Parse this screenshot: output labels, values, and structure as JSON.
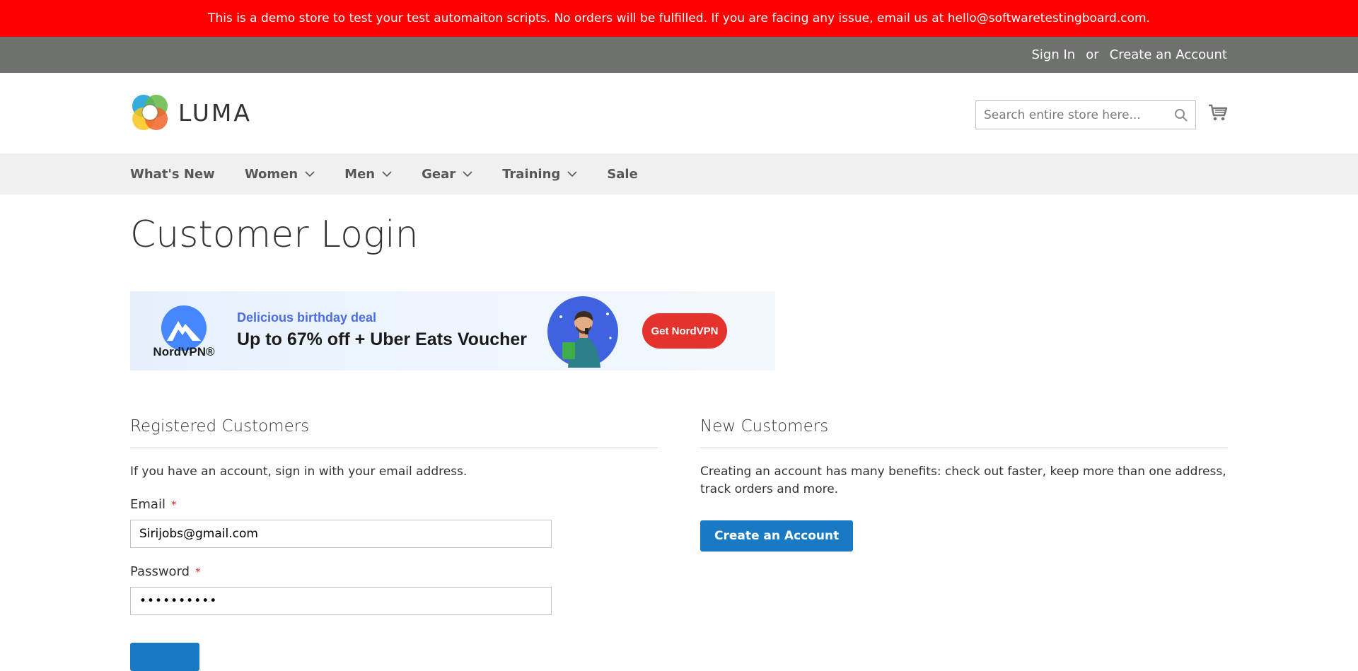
{
  "demo_notice": "This is a demo store to test your test automaiton scripts. No orders will be fulfilled. If you are facing any issue, email us at hello@softwaretestingboard.com.",
  "header": {
    "sign_in": "Sign In",
    "or": "or",
    "create_account": "Create an Account"
  },
  "logo": {
    "text": "LUMA"
  },
  "search": {
    "placeholder": "Search entire store here...",
    "icon": "search-icon"
  },
  "cart": {
    "icon": "cart-icon"
  },
  "nav": {
    "items": [
      {
        "label": "What's New",
        "has_dropdown": false
      },
      {
        "label": "Women",
        "has_dropdown": true
      },
      {
        "label": "Men",
        "has_dropdown": true
      },
      {
        "label": "Gear",
        "has_dropdown": true
      },
      {
        "label": "Training",
        "has_dropdown": true
      },
      {
        "label": "Sale",
        "has_dropdown": false
      }
    ]
  },
  "page_title": "Customer Login",
  "banner": {
    "brand": "NordVPN®",
    "subtitle": "Delicious birthday deal",
    "headline": "Up to 67% off + Uber Eats Voucher",
    "cta": "Get NordVPN"
  },
  "registered": {
    "title": "Registered Customers",
    "intro": "If you have an account, sign in with your email address.",
    "email_label": "Email",
    "email_value": "Sirijobs@gmail.com",
    "password_label": "Password",
    "password_value": "••••••••••",
    "required_mark": "*"
  },
  "new_customers": {
    "title": "New Customers",
    "intro": "Creating an account has many benefits: check out faster, keep more than one address, track orders and more.",
    "button": "Create an Account"
  },
  "colors": {
    "demo_bar": "#ff0000",
    "header_bar": "#6e716e",
    "nav_bg": "#f0f0f0",
    "primary_button": "#1979c3",
    "required": "#e02b27",
    "banner_cta": "#e5322d",
    "banner_accent": "#4b6ce3"
  }
}
